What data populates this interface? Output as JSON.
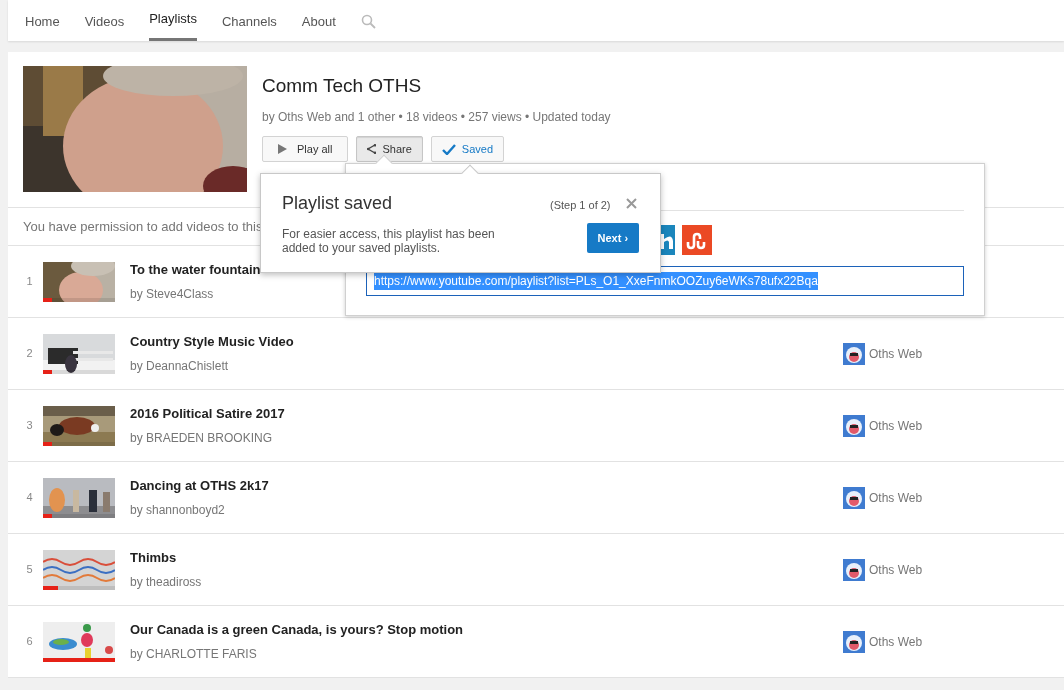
{
  "nav": {
    "tabs": [
      {
        "label": "Home",
        "selected": false
      },
      {
        "label": "Videos",
        "selected": false
      },
      {
        "label": "Playlists",
        "selected": true
      },
      {
        "label": "Channels",
        "selected": false
      },
      {
        "label": "About",
        "selected": false
      }
    ]
  },
  "playlist": {
    "title": "Comm Tech OTHS",
    "meta": "by Oths Web and 1 other • 18 videos • 257 views • Updated today",
    "buttons": [
      {
        "kind": "play",
        "label": "Play all",
        "pressed": false
      },
      {
        "kind": "share",
        "label": "Share",
        "pressed": true
      },
      {
        "kind": "saved",
        "label": "Saved",
        "pressed": false
      }
    ]
  },
  "permission_note": "You have permission to add videos to this",
  "share_panel": {
    "url": "https://www.youtube.com/playlist?list=PLs_O1_XxeFnmkOOZuy6eWKs78ufx22Bqa",
    "url_selected": true
  },
  "tooltip": {
    "title": "Playlist saved",
    "step": "(Step 1 of 2)",
    "body": "For easier access, this playlist has been added to your saved playlists.",
    "button": "Next ›"
  },
  "videos": [
    {
      "index": "1",
      "title": "To the water fountain",
      "author": "by Steve4Class",
      "level": 0.12
    },
    {
      "index": "2",
      "title": "Country Style Music Video",
      "author": "by DeannaChislett",
      "level": 0.12,
      "channel": "Oths Web"
    },
    {
      "index": "3",
      "title": "2016 Political Satire 2017",
      "author": "by BRAEDEN BROOKING",
      "level": 0.12,
      "channel": "Oths Web"
    },
    {
      "index": "4",
      "title": "Dancing at OTHS 2k17",
      "author": "by shannonboyd2",
      "level": 0.12,
      "channel": "Oths Web"
    },
    {
      "index": "5",
      "title": "Thimbs",
      "author": "by theadiross",
      "level": 0.21,
      "channel": "Oths Web"
    },
    {
      "index": "6",
      "title": "Our Canada is a green Canada, is yours? Stop motion",
      "author": "by CHARLOTTE FARIS",
      "level": 1,
      "channel": "Oths Web"
    }
  ]
}
